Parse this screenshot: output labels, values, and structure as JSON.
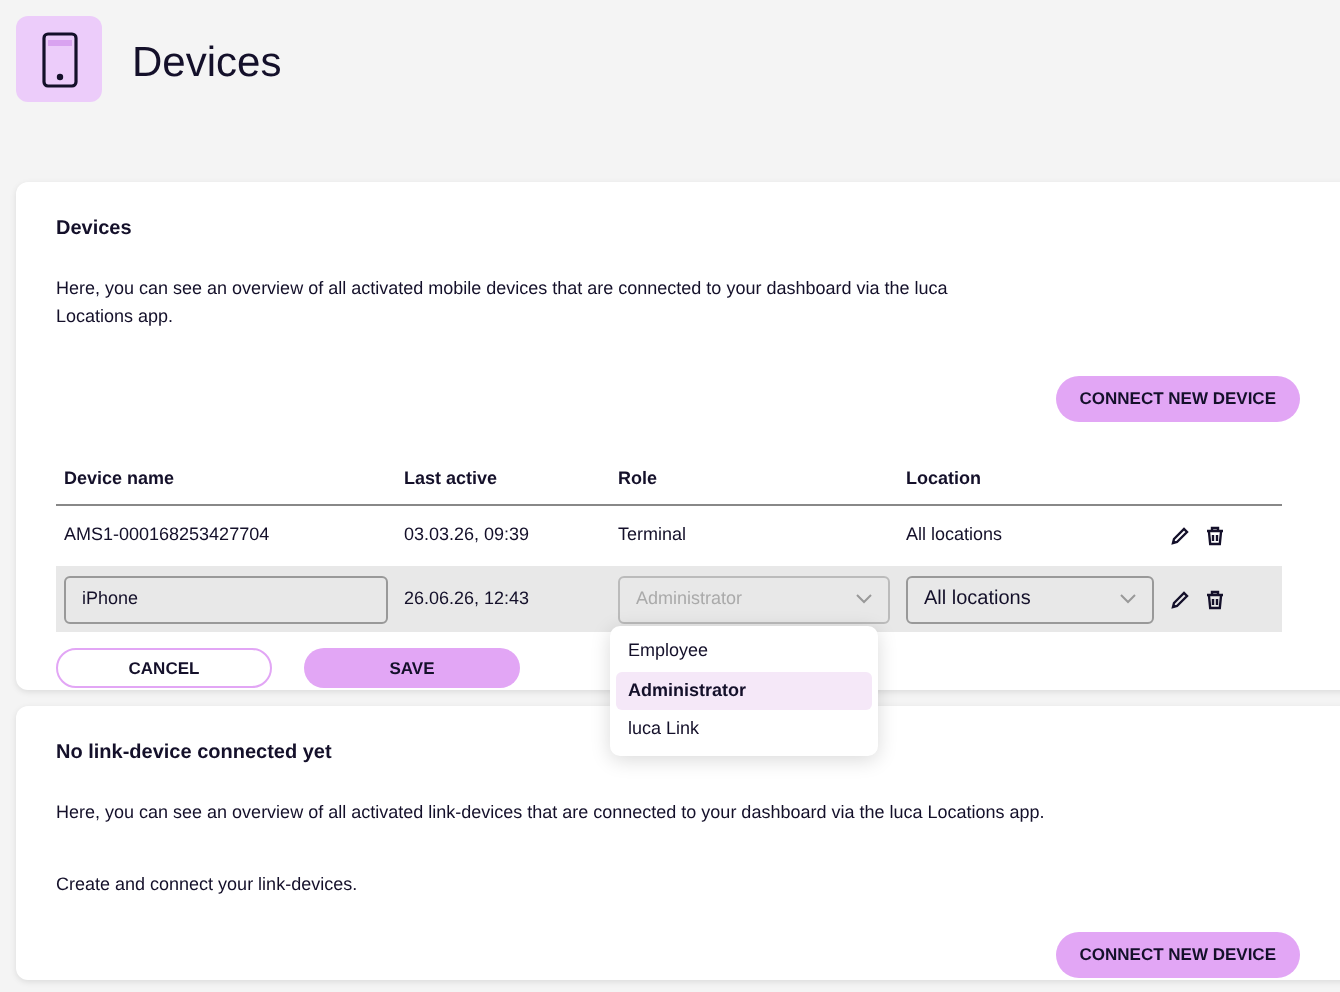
{
  "page_title": "Devices",
  "devices": {
    "title": "Devices",
    "description": "Here, you can see an overview of all activated mobile devices that are connected to your dashboard via the luca Locations app.",
    "connect_button": "CONNECT NEW DEVICE",
    "columns": [
      "Device name",
      "Last active",
      "Role",
      "Location"
    ],
    "rows": [
      {
        "kind": "display",
        "name": "AMS1-000168253427704",
        "last_active": "03.03.26, 09:39",
        "role": "Terminal",
        "location": "All locations"
      },
      {
        "kind": "edit",
        "name": "iPhone",
        "last_active": "26.06.26, 12:43",
        "role": "Administrator",
        "role_disabled": true,
        "location": "All locations",
        "location_disabled": false
      }
    ],
    "role_menu": [
      {
        "label": "Employee",
        "selected": false
      },
      {
        "label": "Administrator",
        "selected": true
      },
      {
        "label": "luca Link",
        "selected": false
      }
    ],
    "cancel_button": "CANCEL",
    "save_button": "SAVE"
  },
  "link_devices": {
    "title": "No link-device connected yet",
    "description": "Here, you can see an overview of all activated link-devices that are connected to your dashboard via the luca Locations app.",
    "note": "Create and connect your link-devices.",
    "connect_button": "CONNECT NEW DEVICE"
  }
}
